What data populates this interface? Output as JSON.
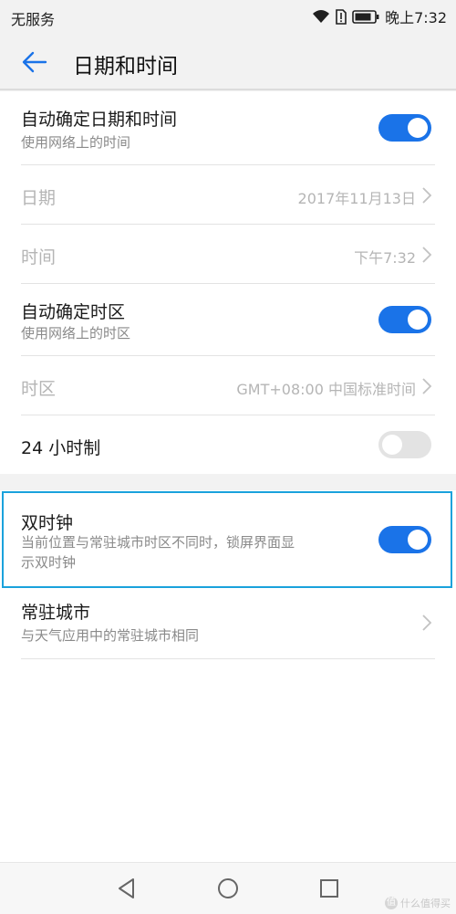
{
  "status_bar": {
    "carrier": "无服务",
    "time": "晚上7:32"
  },
  "app_bar": {
    "title": "日期和时间"
  },
  "settings": {
    "auto_datetime": {
      "title": "自动确定日期和时间",
      "subtitle": "使用网络上的时间",
      "enabled": true
    },
    "date": {
      "title": "日期",
      "value": "2017年11月13日"
    },
    "time": {
      "title": "时间",
      "value": "下午7:32"
    },
    "auto_timezone": {
      "title": "自动确定时区",
      "subtitle": "使用网络上的时区",
      "enabled": true
    },
    "timezone": {
      "title": "时区",
      "value": "GMT+08:00 中国标准时间"
    },
    "hour24": {
      "title": "24 小时制",
      "enabled": false
    },
    "dual_clock": {
      "title": "双时钟",
      "subtitle_line1": "当前位置与常驻城市时区不同时，锁屏界面显",
      "subtitle_line2": "示双时钟",
      "enabled": true
    },
    "home_city": {
      "title": "常驻城市",
      "subtitle": "与天气应用中的常驻城市相同"
    }
  },
  "watermark": {
    "logo": "值",
    "text": "什么值得买"
  },
  "colors": {
    "accent": "#1a73e8",
    "highlight_border": "#1aa2dc",
    "disabled_text": "#b5b5b5"
  },
  "icons": {
    "back": "arrow-left-icon",
    "wifi": "wifi-icon",
    "sim": "sim-alert-icon",
    "battery": "battery-icon",
    "nav_back": "triangle-back-icon",
    "nav_home": "circle-home-icon",
    "nav_recent": "square-recent-icon"
  }
}
